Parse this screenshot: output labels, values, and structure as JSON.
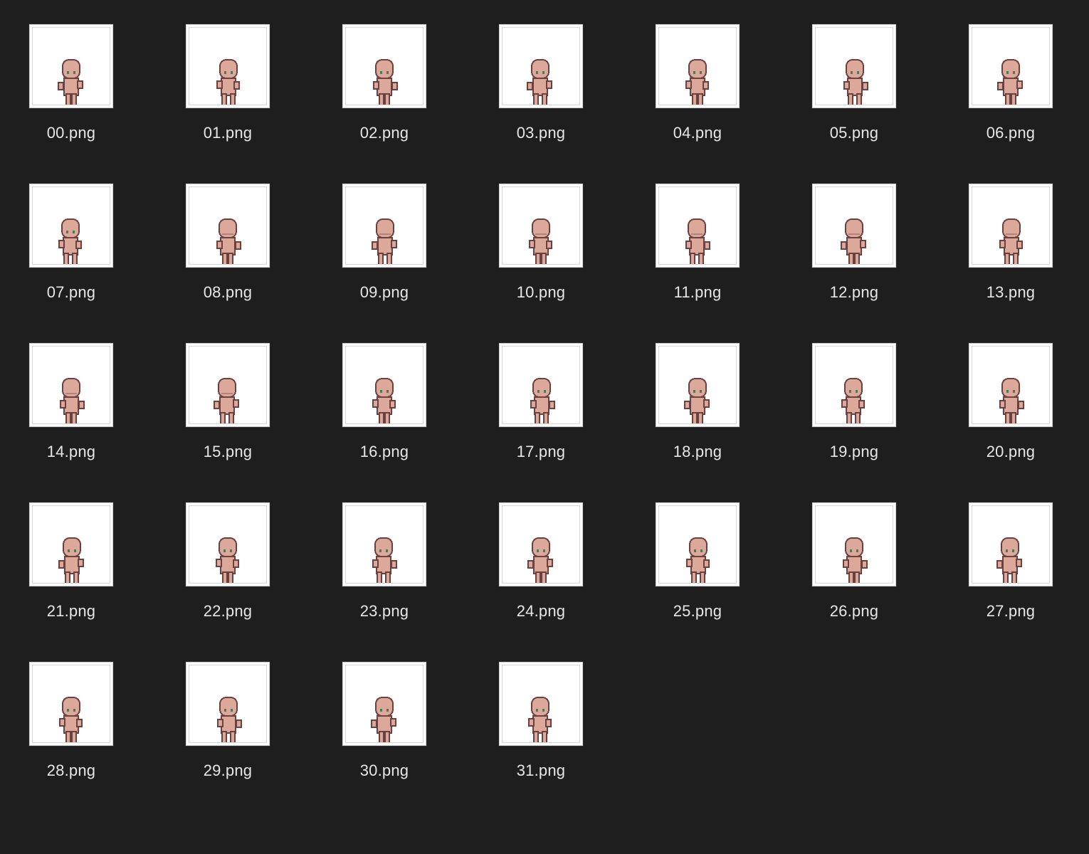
{
  "window": {
    "view": "icon-grid"
  },
  "colors": {
    "background": "#1e1e1e",
    "label": "#e6e6e6",
    "thumb_bg": "#ffffff",
    "skin": "#dba89a",
    "outline": "#6b4040",
    "eye": "#4a7a5a"
  },
  "icons": {
    "file_thumbnail": "pixel-character-sprite-icon"
  },
  "files": [
    {
      "name": "00.png"
    },
    {
      "name": "01.png"
    },
    {
      "name": "02.png"
    },
    {
      "name": "03.png"
    },
    {
      "name": "04.png"
    },
    {
      "name": "05.png"
    },
    {
      "name": "06.png"
    },
    {
      "name": "07.png"
    },
    {
      "name": "08.png"
    },
    {
      "name": "09.png"
    },
    {
      "name": "10.png"
    },
    {
      "name": "11.png"
    },
    {
      "name": "12.png"
    },
    {
      "name": "13.png"
    },
    {
      "name": "14.png"
    },
    {
      "name": "15.png"
    },
    {
      "name": "16.png"
    },
    {
      "name": "17.png"
    },
    {
      "name": "18.png"
    },
    {
      "name": "19.png"
    },
    {
      "name": "20.png"
    },
    {
      "name": "21.png"
    },
    {
      "name": "22.png"
    },
    {
      "name": "23.png"
    },
    {
      "name": "24.png"
    },
    {
      "name": "25.png"
    },
    {
      "name": "26.png"
    },
    {
      "name": "27.png"
    },
    {
      "name": "28.png"
    },
    {
      "name": "29.png"
    },
    {
      "name": "30.png"
    },
    {
      "name": "31.png"
    }
  ]
}
